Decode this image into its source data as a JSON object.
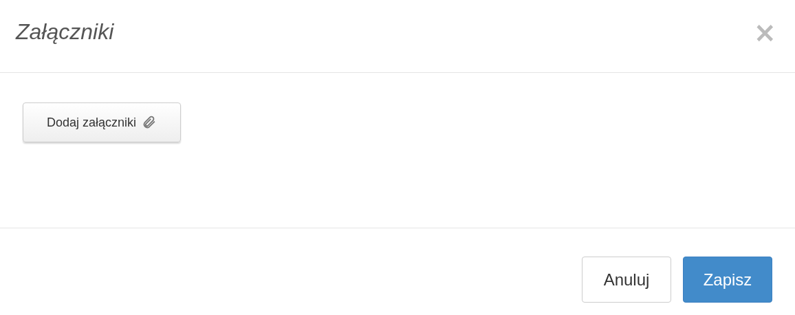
{
  "dialog": {
    "title": "Załączniki",
    "close": "×"
  },
  "body": {
    "add_button": "Dodaj załączniki"
  },
  "footer": {
    "buttons": [
      {
        "label": "Anuluj",
        "kind": "default"
      },
      {
        "label": "Zapisz",
        "kind": "primary"
      }
    ]
  }
}
